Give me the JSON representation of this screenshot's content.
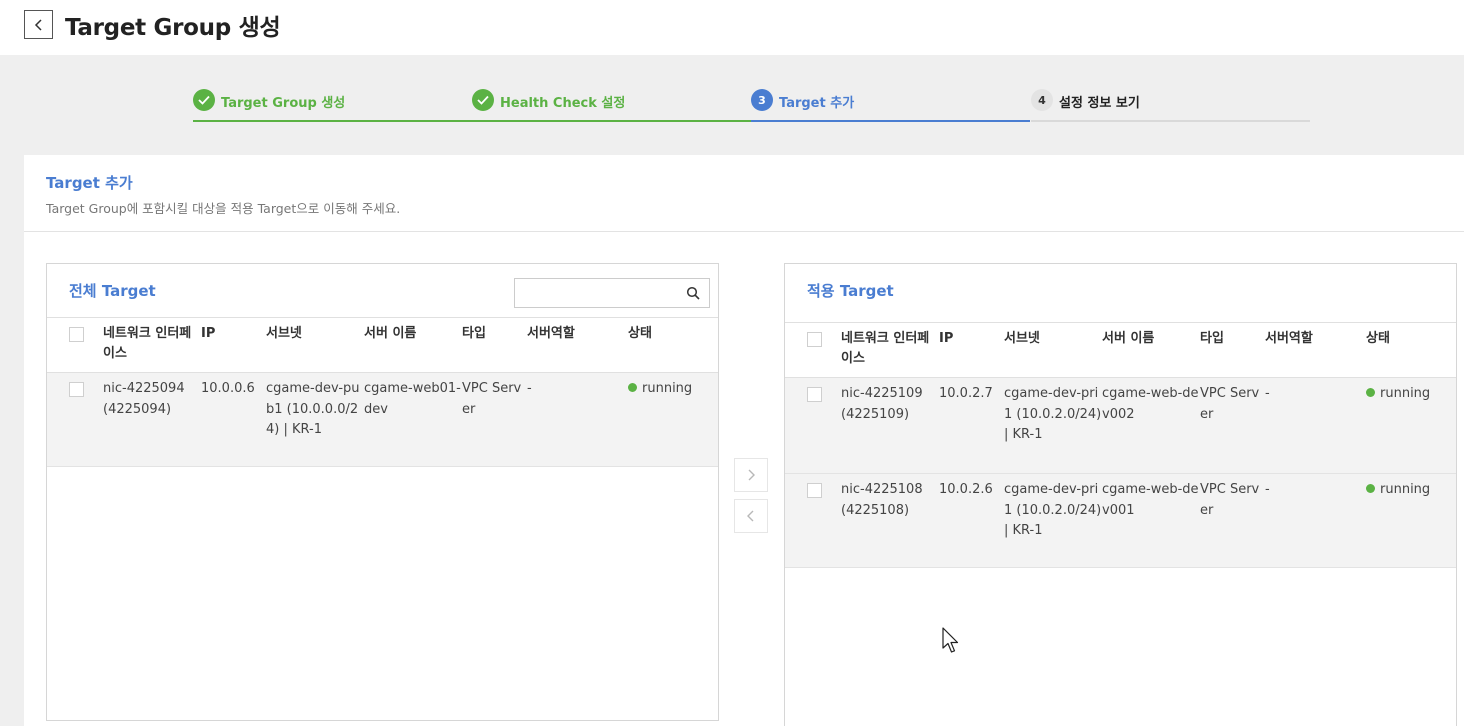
{
  "header": {
    "title": "Target Group 생성",
    "back_icon": "chevron-left-icon"
  },
  "stepper": {
    "steps": [
      {
        "label": "Target Group 생성",
        "state": "done"
      },
      {
        "label": "Health Check 설정",
        "state": "done"
      },
      {
        "number": "3",
        "label": "Target 추가",
        "state": "current"
      },
      {
        "number": "4",
        "label": "설정 정보 보기",
        "state": "todo"
      }
    ]
  },
  "section": {
    "title": "Target 추가",
    "description": "Target Group에 포함시킬 대상을 적용 Target으로 이동해 주세요."
  },
  "columns": [
    "네트워크 인터페이스",
    "IP",
    "서브넷",
    "서버 이름",
    "타입",
    "서버역할",
    "상태"
  ],
  "all_targets": {
    "title": "전체 Target",
    "search_placeholder": "",
    "rows": [
      {
        "nic": "nic-4225094 (4225094)",
        "ip": "10.0.0.6",
        "subnet": "cgame-dev-pub1 (10.0.0.0/24) | KR-1",
        "server_name": "cgame-web01-dev",
        "type": "VPC Server",
        "role": "-",
        "status": "running"
      }
    ]
  },
  "applied_targets": {
    "title": "적용 Target",
    "rows": [
      {
        "nic": "nic-4225109 (4225109)",
        "ip": "10.0.2.7",
        "subnet": "cgame-dev-pri1 (10.0.2.0/24) | KR-1",
        "server_name": "cgame-web-dev002",
        "type": "VPC Server",
        "role": "-",
        "status": "running"
      },
      {
        "nic": "nic-4225108 (4225108)",
        "ip": "10.0.2.6",
        "subnet": "cgame-dev-pri1 (10.0.2.0/24) | KR-1",
        "server_name": "cgame-web-dev001",
        "type": "VPC Server",
        "role": "-",
        "status": "running"
      }
    ]
  },
  "colors": {
    "accent": "#4a7dd1",
    "success": "#5bb244"
  }
}
